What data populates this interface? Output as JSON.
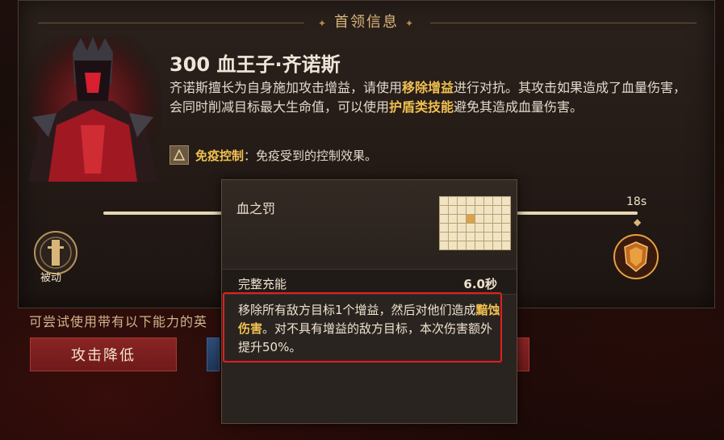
{
  "panel": {
    "title": "首领信息"
  },
  "boss": {
    "name": "300 血王子·齐诺斯",
    "desc_1": "齐诺斯擅长为自身施加攻击增益，请使用",
    "desc_hl1": "移除增益",
    "desc_2": "进行对抗。其攻击如果造成了血量伤害，会同时削减目标最大生命值，可以使用",
    "desc_hl2": "护盾类技能",
    "desc_3": "避免其造成血量伤害。",
    "immune_label": "免疫控制",
    "immune_text": "：免疫受到的控制效果。"
  },
  "timeline": {
    "left_label": "被动",
    "time_marker": "18s"
  },
  "hint": "可尝试使用带有以下能力的英",
  "buttons": {
    "attack_down": "攻击降低"
  },
  "tooltip": {
    "skill_name": "血之罚",
    "charge_label": "完整充能",
    "charge_value": "6.0秒",
    "desc_1": "移除所有敌方目标1个增益，然后对他们造成",
    "desc_hl": "黯蚀伤害",
    "desc_2": "。对不具有增益的敌方目标，本次伤害额外提升50%。"
  },
  "colors": {
    "accent_gold": "#f0c050",
    "highlight_box": "#e21f1f"
  }
}
